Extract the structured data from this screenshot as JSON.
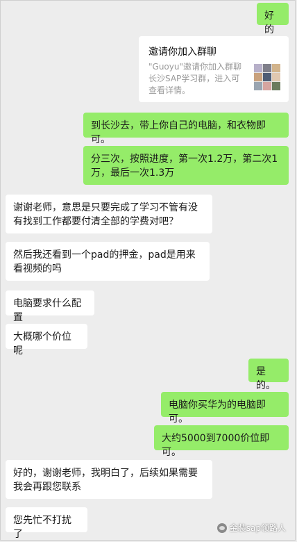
{
  "messages": [
    {
      "side": "right",
      "text": "好的"
    },
    {
      "side": "card",
      "title": "邀请你加入群聊",
      "desc": "\"Guoyu\"邀请你加入群聊长沙SAP学习群，进入可查看详情。"
    },
    {
      "side": "right",
      "text": "到长沙去，带上你自己的电脑，和衣物即可。"
    },
    {
      "side": "right",
      "text": "分三次，按照进度，第一次1.2万，第二次1万，最后一次1.3万"
    },
    {
      "side": "left",
      "text": "谢谢老师，意思是只要完成了学习不管有没有找到工作都要付清全部的学费对吧？"
    },
    {
      "side": "left",
      "text": "然后我还看到一个pad的押金，pad是用来看视频的吗"
    },
    {
      "side": "left",
      "text": "电脑要求什么配置"
    },
    {
      "side": "left",
      "text": "大概哪个价位呢"
    },
    {
      "side": "right",
      "text": "是的。"
    },
    {
      "side": "right",
      "text": "电脑你买华为的电脑即可。"
    },
    {
      "side": "right",
      "text": "大约5000到7000价位即可。"
    },
    {
      "side": "left",
      "text": "好的，谢谢老师，我明白了，后续如果需要我会再跟您联系"
    },
    {
      "side": "left",
      "text": "您先忙不打扰了"
    }
  ],
  "watermark": {
    "text": "金装sap领路人",
    "icon": "wechat-icon"
  },
  "colors": {
    "me_bubble": "#95ec69",
    "other_bubble": "#ffffff",
    "background": "#ededed"
  }
}
